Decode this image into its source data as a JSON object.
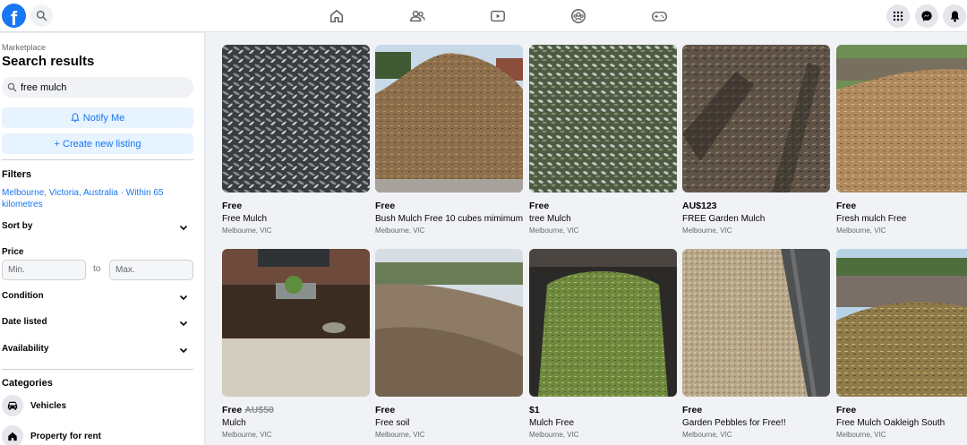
{
  "nav": {
    "logo_letter": "f",
    "icons": [
      "home-icon",
      "friends-icon",
      "watch-icon",
      "groups-icon",
      "gaming-icon"
    ],
    "right": [
      "menu-grid-icon",
      "messenger-icon",
      "notifications-icon"
    ]
  },
  "sidebar": {
    "breadcrumb": "Marketplace",
    "title": "Search results",
    "search_value": "free mulch",
    "notify_label": "Notify Me",
    "create_label": "+ Create new listing",
    "filters_title": "Filters",
    "location": "Melbourne, Victoria, Australia · Within 65 kilometres",
    "sort_by": "Sort by",
    "price_label": "Price",
    "min_placeholder": "Min.",
    "to_label": "to",
    "max_placeholder": "Max.",
    "condition": "Condition",
    "date_listed": "Date listed",
    "availability": "Availability",
    "categories_title": "Categories",
    "categories": [
      {
        "label": "Vehicles",
        "icon": "car-icon"
      },
      {
        "label": "Property for rent",
        "icon": "house-icon"
      }
    ]
  },
  "listings": [
    {
      "price": "Free",
      "old_price": "",
      "title": "Free Mulch",
      "location": "Melbourne, VIC"
    },
    {
      "price": "Free",
      "old_price": "",
      "title": "Bush Mulch Free 10 cubes mimimum",
      "location": "Melbourne, VIC"
    },
    {
      "price": "Free",
      "old_price": "",
      "title": "tree Mulch",
      "location": "Melbourne, VIC"
    },
    {
      "price": "AU$123",
      "old_price": "",
      "title": "FREE Garden Mulch",
      "location": "Melbourne, VIC"
    },
    {
      "price": "Free",
      "old_price": "",
      "title": "Fresh mulch Free",
      "location": "Melbourne, VIC"
    },
    {
      "price": "Free",
      "old_price": "AU$50",
      "title": "Mulch",
      "location": "Melbourne, VIC"
    },
    {
      "price": "Free",
      "old_price": "",
      "title": "Free soil",
      "location": "Melbourne, VIC"
    },
    {
      "price": "$1",
      "old_price": "",
      "title": "Mulch Free",
      "location": "Melbourne, VIC"
    },
    {
      "price": "Free",
      "old_price": "",
      "title": "Garden Pebbles for Free!!",
      "location": "Melbourne, VIC"
    },
    {
      "price": "Free",
      "old_price": "",
      "title": "Free Mulch Oakleigh South",
      "location": "Melbourne, VIC"
    }
  ],
  "colors": {
    "brand": "#1877f2",
    "notify_bg": "#e7f3ff",
    "page_bg": "#f0f2f5"
  }
}
